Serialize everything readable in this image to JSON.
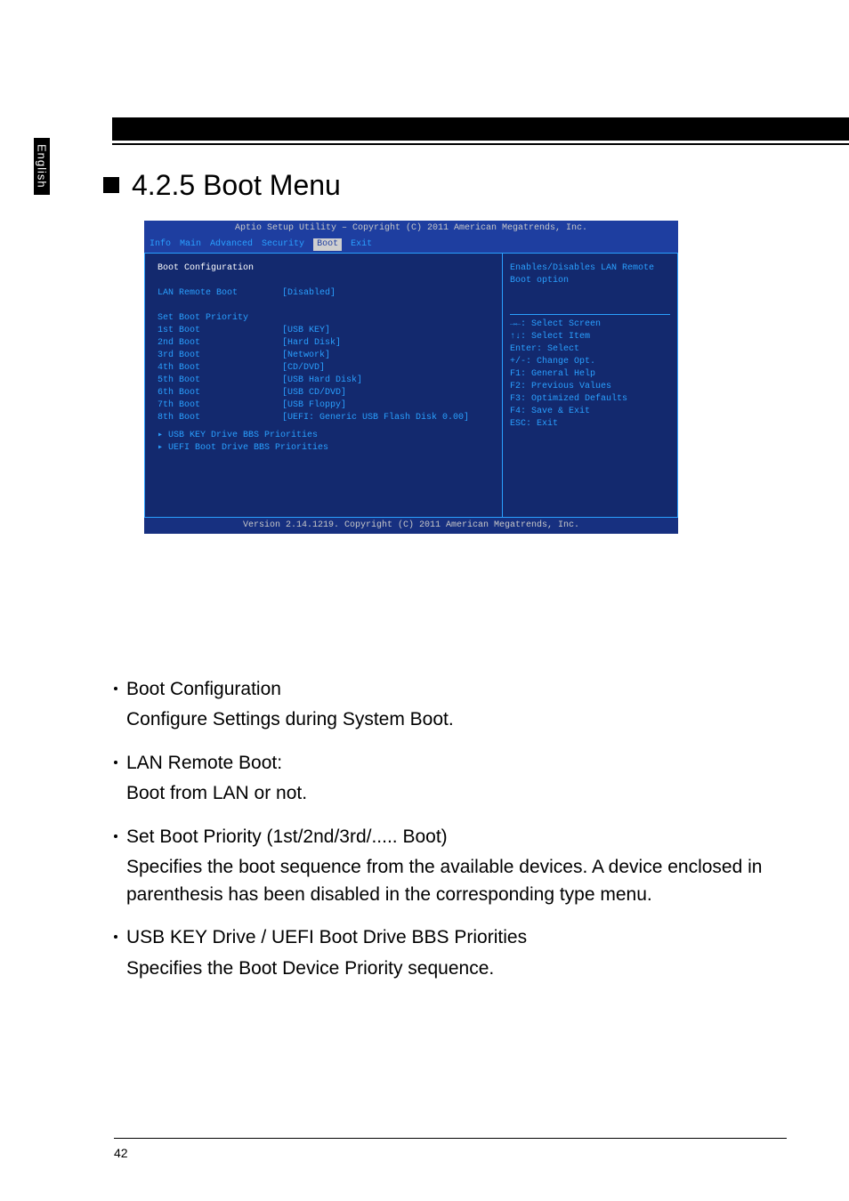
{
  "side_tab": "English",
  "heading": "4.2.5 Boot Menu",
  "bios": {
    "header": "Aptio Setup Utility – Copyright (C) 2011 American Megatrends, Inc.",
    "tabs": [
      "Info",
      "Main",
      "Advanced",
      "Security",
      "Boot",
      "Exit"
    ],
    "selected_tab_index": 4,
    "section_title": "Boot Configuration",
    "lan_remote": {
      "label": "LAN Remote Boot",
      "value": "[Disabled]"
    },
    "priority_title": "Set Boot Priority",
    "boots": [
      {
        "label": "1st Boot",
        "value": "[USB KEY]"
      },
      {
        "label": "2nd Boot",
        "value": "[Hard Disk]"
      },
      {
        "label": "3rd Boot",
        "value": "[Network]"
      },
      {
        "label": "4th Boot",
        "value": "[CD/DVD]"
      },
      {
        "label": "5th Boot",
        "value": "[USB Hard Disk]"
      },
      {
        "label": "6th Boot",
        "value": "[USB CD/DVD]"
      },
      {
        "label": "7th Boot",
        "value": "[USB Floppy]"
      },
      {
        "label": "8th Boot",
        "value": "[UEFI: Generic USB Flash Disk 0.00]"
      }
    ],
    "submenus": [
      "USB KEY Drive BBS Priorities",
      "UEFI Boot Drive BBS Priorities"
    ],
    "help_top": "Enables/Disables LAN Remote Boot option",
    "help_keys": [
      "→←: Select Screen",
      "↑↓: Select Item",
      "Enter: Select",
      "+/-: Change Opt.",
      "F1: General Help",
      "F2: Previous Values",
      "F3: Optimized Defaults",
      "F4: Save & Exit",
      "ESC: Exit"
    ],
    "footer": "Version 2.14.1219. Copyright (C) 2011 American Megatrends, Inc."
  },
  "bullets": [
    {
      "title": "Boot Configuration",
      "desc": "Configure Settings during System Boot."
    },
    {
      "title": "LAN Remote Boot:",
      "desc": "Boot from LAN or not."
    },
    {
      "title": "Set Boot Priority (1st/2nd/3rd/..... Boot)",
      "desc": "Specifies the boot sequence from the available devices. A device enclosed in parenthesis has been disabled in the corresponding type menu."
    },
    {
      "title": "USB KEY Drive / UEFI Boot Drive BBS Priorities",
      "desc": "Specifies the Boot Device Priority sequence."
    }
  ],
  "page_number": "42"
}
